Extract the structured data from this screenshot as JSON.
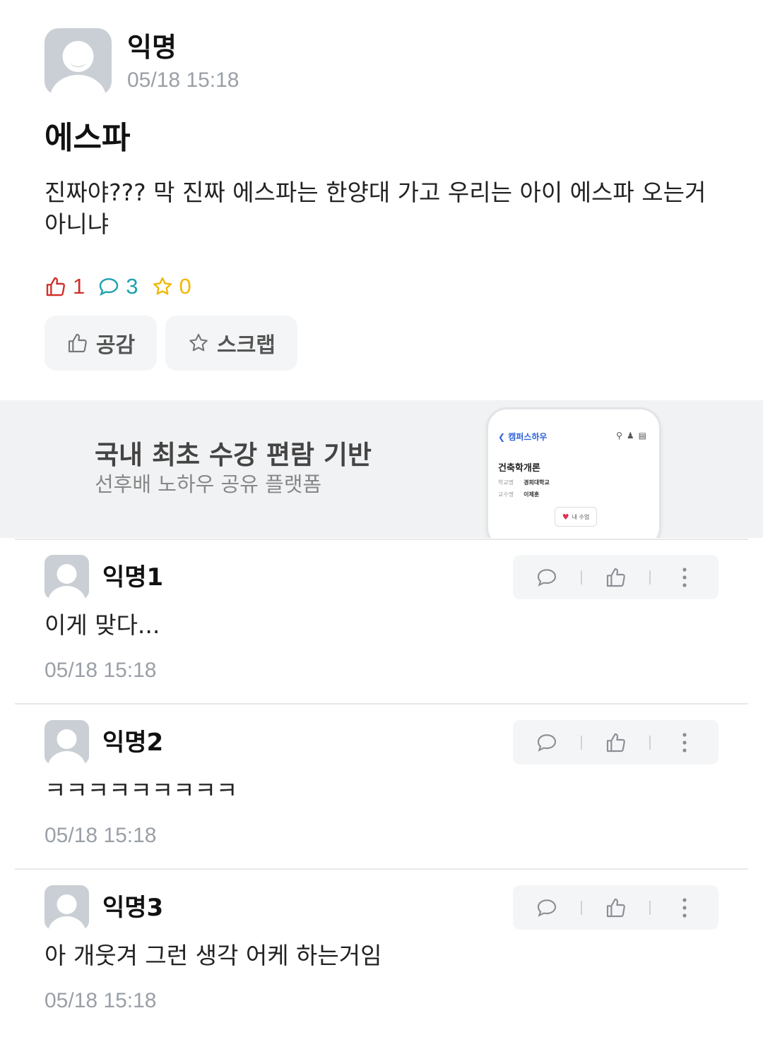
{
  "post": {
    "author": "익명",
    "time": "05/18 15:18",
    "title": "에스파",
    "body": "진짜야??? 막 진짜 에스파는 한양대 가고 우리는 아이 에스파 오는거 아니냐",
    "stats": {
      "likes": "1",
      "comments": "3",
      "scraps": "0"
    },
    "actions": {
      "like_label": "공감",
      "scrap_label": "스크랩"
    }
  },
  "ad": {
    "headline": "국내 최초 수강 편람 기반",
    "subtext": "선후배 노하우 공유 플랫폼",
    "phone": {
      "brand": "캠퍼스하우",
      "course": "건축학개론",
      "rows": [
        {
          "label": "학교명",
          "value": "경희대학교"
        },
        {
          "label": "교수명",
          "value": "이제훈"
        }
      ],
      "button": "내 수업"
    }
  },
  "comments": [
    {
      "author": "익명1",
      "text": "이게 맞다...",
      "time": "05/18 15:18"
    },
    {
      "author": "익명2",
      "text": "ㅋㅋㅋㅋㅋㅋㅋㅋㅋ",
      "time": "05/18 15:18"
    },
    {
      "author": "익명3",
      "text": "아 개웃겨 그런 생각 어케 하는거임",
      "time": "05/18 15:18"
    }
  ],
  "colors": {
    "like": "#d1312a",
    "comment": "#1ea1b1",
    "scrap": "#f2b705"
  },
  "icons": [
    "avatar-placeholder-icon",
    "thumbs-up-icon",
    "comment-bubble-icon",
    "star-icon",
    "more-vertical-icon",
    "search-icon",
    "user-icon",
    "cart-icon",
    "heart-icon"
  ]
}
